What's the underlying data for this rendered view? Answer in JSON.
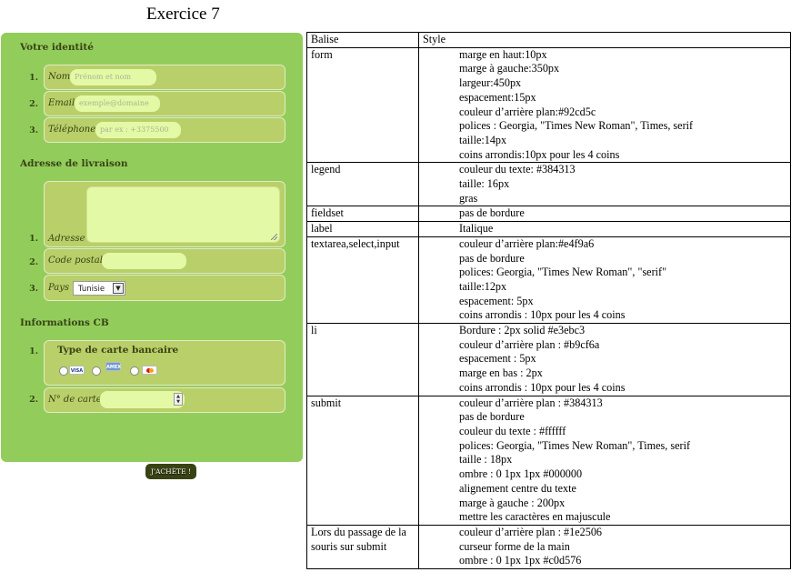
{
  "page_title": "Exercice 7",
  "form": {
    "identity": {
      "legend": "Votre identité",
      "items": [
        {
          "num": "1.",
          "label": "Nom",
          "placeholder": "Prénom et nom"
        },
        {
          "num": "2.",
          "label": "Email",
          "placeholder": "exemple@domaine"
        },
        {
          "num": "3.",
          "label": "Téléphone",
          "placeholder": "par ex : +3375500"
        }
      ]
    },
    "delivery": {
      "legend": "Adresse de livraison",
      "items": [
        {
          "num": "1.",
          "label": "Adresse"
        },
        {
          "num": "2.",
          "label": "Code postal"
        },
        {
          "num": "3.",
          "label": "Pays",
          "select_value": "Tunisie"
        }
      ]
    },
    "cb": {
      "legend": "Informations CB",
      "card_num": "1.",
      "card_type_title": "Type de carte bancaire",
      "cards": [
        "VISA",
        "AMEX",
        "MC"
      ],
      "number_num": "2.",
      "number_label": "N° de carte"
    },
    "submit_label": "J'achète !"
  },
  "table": {
    "headers": [
      "Balise",
      "Style"
    ],
    "rows": [
      {
        "tag": "form",
        "styles": [
          "marge en haut:10px",
          "marge à gauche:350px",
          "largeur:450px",
          "espacement:15px",
          "couleur d’arrière plan:#92cd5c",
          "polices : Georgia, \"Times New Roman\", Times, serif",
          "taille:14px",
          "coins arrondis:10px pour les 4 coins"
        ]
      },
      {
        "tag": "legend",
        "styles": [
          "couleur du texte: #384313",
          "taille: 16px",
          "gras"
        ]
      },
      {
        "tag": "fieldset",
        "styles": [
          "pas de bordure"
        ]
      },
      {
        "tag": "label",
        "styles": [
          "Italique"
        ]
      },
      {
        "tag": "textarea,select,input",
        "styles": [
          "couleur d’arrière plan:#e4f9a6",
          "pas de bordure",
          "polices: Georgia, \"Times New Roman\", \"serif\"",
          "taille:12px",
          "espacement: 5px",
          "coins arrondis : 10px pour les 4 coins"
        ]
      },
      {
        "tag": "li",
        "styles": [
          "Bordure : 2px solid #e3ebc3",
          "couleur d’arrière plan : #b9cf6a",
          "espacement : 5px",
          "marge en bas : 2px",
          "coins arrondis : 10px pour les 4 coins"
        ]
      },
      {
        "tag": "submit",
        "styles": [
          "couleur d’arrière plan : #384313",
          "pas de bordure",
          "couleur du texte : #ffffff",
          "polices: Georgia, \"Times New Roman\", Times, serif",
          "taille : 18px",
          "ombre : 0 1px 1px #000000",
          "alignement centre du texte",
          "marge à gauche : 200px",
          "mettre les caractères en majuscule"
        ]
      },
      {
        "tag": "Lors du passage de la souris sur submit",
        "styles": [
          "couleur d’arrière plan : #1e2506",
          "curseur forme de la main",
          "ombre : 0 1px 1px #c0d576"
        ]
      }
    ]
  }
}
